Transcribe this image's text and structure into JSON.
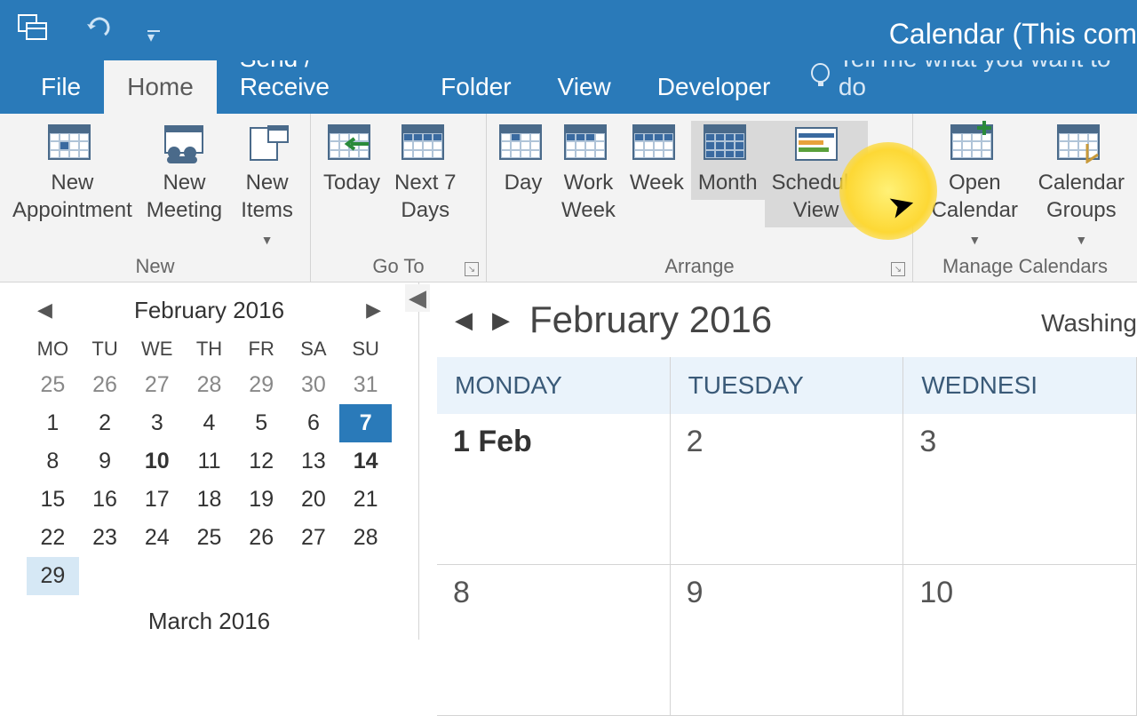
{
  "titlebar": {
    "app_title": "Calendar (This com"
  },
  "tabs": {
    "file": "File",
    "home": "Home",
    "send_receive": "Send / Receive",
    "folder": "Folder",
    "view": "View",
    "developer": "Developer",
    "tell_me": "Tell me what you want to do"
  },
  "ribbon": {
    "groups": {
      "new": "New",
      "goto": "Go To",
      "arrange": "Arrange",
      "manage": "Manage Calendars"
    },
    "new_appointment_l1": "New",
    "new_appointment_l2": "Appointment",
    "new_meeting_l1": "New",
    "new_meeting_l2": "Meeting",
    "new_items_l1": "New",
    "new_items_l2": "Items",
    "today": "Today",
    "next7_l1": "Next 7",
    "next7_l2": "Days",
    "day": "Day",
    "workweek_l1": "Work",
    "workweek_l2": "Week",
    "week": "Week",
    "month": "Month",
    "schedule_l1": "Schedule",
    "schedule_l2": "View",
    "open_cal_l1": "Open",
    "open_cal_l2": "Calendar",
    "cal_groups_l1": "Calendar",
    "cal_groups_l2": "Groups"
  },
  "mini": {
    "title": "February 2016",
    "dow": [
      "MO",
      "TU",
      "WE",
      "TH",
      "FR",
      "SA",
      "SU"
    ],
    "prev_days": [
      "25",
      "26",
      "27",
      "28",
      "29",
      "30",
      "31"
    ],
    "weeks": [
      [
        "1",
        "2",
        "3",
        "4",
        "5",
        "6",
        "7"
      ],
      [
        "8",
        "9",
        "10",
        "11",
        "12",
        "13",
        "14"
      ],
      [
        "15",
        "16",
        "17",
        "18",
        "19",
        "20",
        "21"
      ],
      [
        "22",
        "23",
        "24",
        "25",
        "26",
        "27",
        "28"
      ],
      [
        "29",
        "",
        "",
        "",
        "",
        "",
        ""
      ]
    ],
    "next_title": "March 2016"
  },
  "main": {
    "title": "February 2016",
    "location": "Washing",
    "cols": [
      "MONDAY",
      "TUESDAY",
      "WEDNESI"
    ],
    "row1": [
      "1 Feb",
      "2",
      "3"
    ],
    "row2": [
      "8",
      "9",
      "10"
    ]
  }
}
